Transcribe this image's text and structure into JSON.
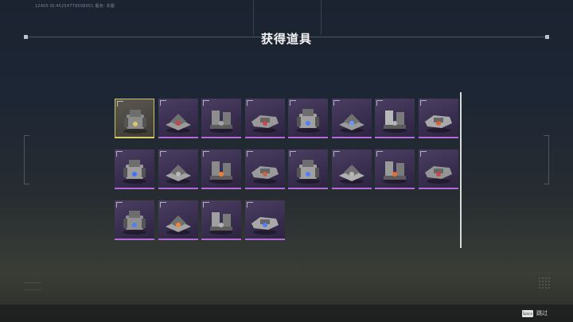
{
  "header": {
    "uid": "12405 ID:45254779508051   服务: 本服",
    "title": "获得道具"
  },
  "items": [
    {
      "name": "mech-unit-icon",
      "accent": "#8a8a8a",
      "glow": "#e0d060",
      "selected": true
    },
    {
      "name": "red-turret-icon",
      "accent": "#9a9a9a",
      "glow": "#d04040"
    },
    {
      "name": "twin-cannon-icon",
      "accent": "#8e8e8e",
      "glow": "#b0b0b0"
    },
    {
      "name": "spiked-bar-icon",
      "accent": "#999999",
      "glow": "#d04040"
    },
    {
      "name": "blue-tower-icon",
      "accent": "#a0a0a0",
      "glow": "#4a7bff"
    },
    {
      "name": "hover-tank-icon",
      "accent": "#9a9a9a",
      "glow": "#6aa0ff"
    },
    {
      "name": "steel-plate-icon",
      "accent": "#b8b8b8",
      "glow": "#c0c0c0"
    },
    {
      "name": "red-plate-icon",
      "accent": "#a9a9a9",
      "glow": "#e05a30"
    },
    {
      "name": "blue-jet-icon",
      "accent": "#9c9c9c",
      "glow": "#3a70ff"
    },
    {
      "name": "gray-jet-icon",
      "accent": "#a3a3a3",
      "glow": "#c0c0c0"
    },
    {
      "name": "orange-mech-icon",
      "accent": "#8a8a8a",
      "glow": "#ff8a30"
    },
    {
      "name": "dome-turret-icon",
      "accent": "#9a9a9a",
      "glow": "#d06040"
    },
    {
      "name": "blue-pad-icon",
      "accent": "#a0a0a0",
      "glow": "#4a7bff"
    },
    {
      "name": "ridge-block-icon",
      "accent": "#b0b0b0",
      "glow": "#c0c0c0"
    },
    {
      "name": "twin-missile-icon",
      "accent": "#9a9a9a",
      "glow": "#ff7030"
    },
    {
      "name": "pillar-tower-icon",
      "accent": "#959595",
      "glow": "#d04040"
    },
    {
      "name": "walker-mech-icon",
      "accent": "#8f8f8f",
      "glow": "#4a7bff"
    },
    {
      "name": "booster-tower-icon",
      "accent": "#a4a4a4",
      "glow": "#ff8a30"
    },
    {
      "name": "satellite-gun-icon",
      "accent": "#a0a0a0",
      "glow": "#c0c0c0"
    },
    {
      "name": "thruster-frame-icon",
      "accent": "#a8a8a8",
      "glow": "#4a7bff"
    }
  ],
  "footer": {
    "skip_key": "Space",
    "skip_label": "跳过"
  }
}
